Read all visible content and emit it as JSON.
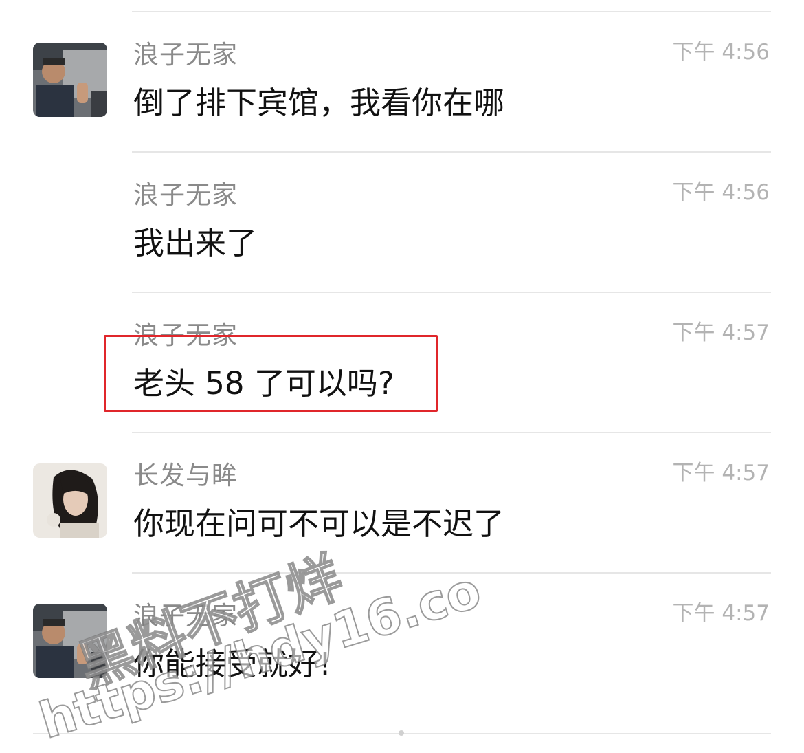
{
  "messages": [
    {
      "sender": "浪子无家",
      "time": "下午 4:56",
      "text": "倒了排下宾馆，我看你在哪",
      "avatar": "man-in-car-avatar"
    },
    {
      "sender": "浪子无家",
      "time": "下午 4:56",
      "text": "我出来了",
      "avatar": ""
    },
    {
      "sender": "浪子无家",
      "time": "下午 4:57",
      "text": "老头 58 了可以吗?",
      "avatar": "",
      "highlighted": true
    },
    {
      "sender": "长发与眸",
      "time": "下午 4:57",
      "text": "你现在问可不可以是不迟了",
      "avatar": "long-hair-woman-avatar"
    },
    {
      "sender": "浪子无家",
      "time": "下午 4:57",
      "text": "你能接受就好!",
      "avatar": "man-in-car-avatar"
    }
  ],
  "watermark": {
    "line1": "黑料不打烊",
    "line2": "https://hdy16.co"
  },
  "colors": {
    "highlight_border": "#e0262b",
    "sender_text": "#8a8a8a",
    "time_text": "#b3b3b3",
    "message_text": "#111111",
    "divider": "#e6e6e6"
  }
}
